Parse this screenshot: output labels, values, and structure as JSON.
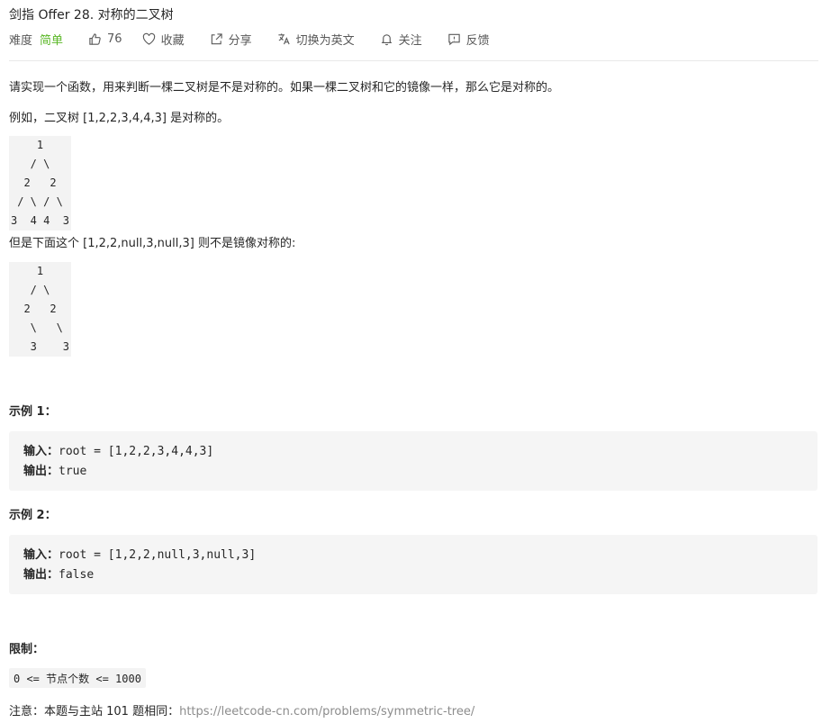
{
  "problem": {
    "title": "剑指 Offer 28. 对称的二叉树",
    "difficulty_label": "难度",
    "difficulty": "简单",
    "colors": {
      "difficulty": "#5ab726",
      "link": "#8c8c8c"
    }
  },
  "actions": {
    "likes": "76",
    "favorite": "收藏",
    "share": "分享",
    "switch_language": "切换为英文",
    "follow": "关注",
    "feedback": "反馈"
  },
  "description": {
    "intro": "请实现一个函数，用来判断一棵二叉树是不是对称的。如果一棵二叉树和它的镜像一样，那么它是对称的。",
    "example_symmetric": "例如，二叉树 [1,2,2,3,4,4,3] 是对称的。",
    "tree_symmetric": "    1\n   / \\\n  2   2\n / \\ / \\\n3  4 4  3",
    "example_asymmetric": "但是下面这个 [1,2,2,null,3,null,3] 则不是镜像对称的:",
    "tree_asymmetric": "    1\n   / \\\n  2   2\n   \\   \\\n   3    3"
  },
  "examples": [
    {
      "heading": "示例 1：",
      "input_label": "输入：",
      "input": "root = [1,2,2,3,4,4,3]",
      "output_label": "输出：",
      "output": "true"
    },
    {
      "heading": "示例 2：",
      "input_label": "输入：",
      "input": "root = [1,2,2,null,3,null,3]",
      "output_label": "输出：",
      "output": "false"
    }
  ],
  "constraints": {
    "heading": "限制：",
    "items": [
      "0 <= 节点个数 <= 1000"
    ]
  },
  "note": {
    "prefix": "注意：本题与主站 101 题相同：",
    "link_text": "https://leetcode-cn.com/problems/symmetric-tree/"
  }
}
